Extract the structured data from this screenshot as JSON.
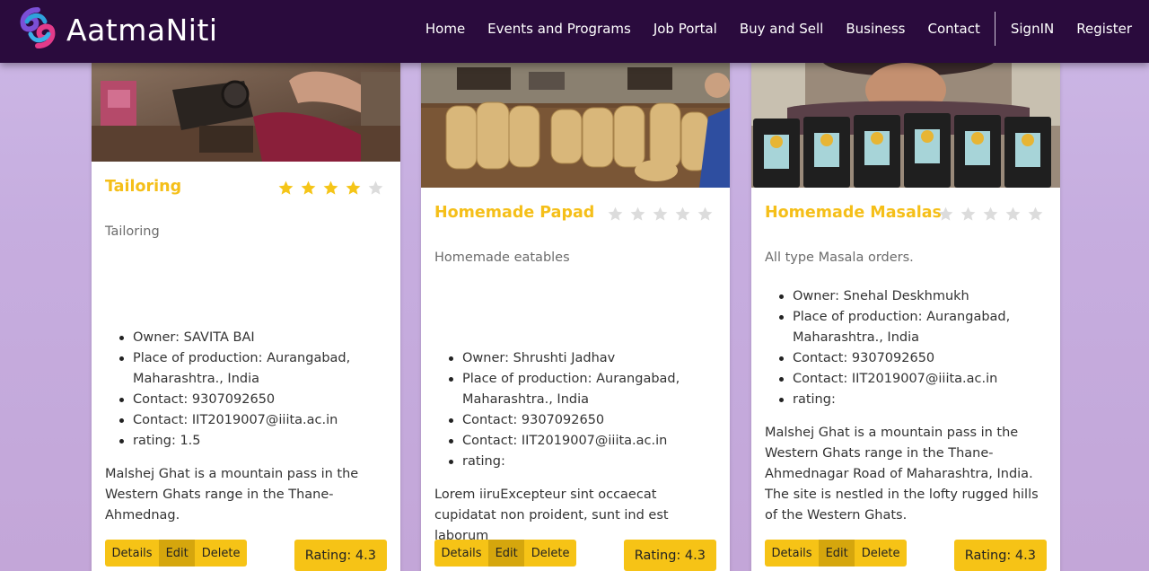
{
  "nav": {
    "brand": "AatmaNiti",
    "links": [
      "Home",
      "Events and Programs",
      "Job Portal",
      "Buy and Sell",
      "Business",
      "Contact"
    ],
    "signin": "SignIN",
    "register": "Register"
  },
  "colors": {
    "navbar": "#2a0b3d",
    "accent": "#f5bf19",
    "star_filled": "#f5c518",
    "star_empty": "#dcdcdc"
  },
  "cards": [
    {
      "title": "Tailoring",
      "stars_filled": 4,
      "stars_total": 5,
      "description": "Tailoring",
      "info": [
        "Owner: SAVITA BAI",
        "Place of production: Aurangabad, Maharashtra., India",
        "Contact: 9307092650",
        "Contact: IIT2019007@iiita.ac.in",
        "rating: 1.5"
      ],
      "text": "Malshej Ghat is a mountain pass in the Western Ghats range in the Thane-Ahmednag.",
      "buttons": {
        "details": "Details",
        "edit": "Edit",
        "delete": "Delete"
      },
      "rating": "Rating: 4.3"
    },
    {
      "title": "Homemade Papad",
      "stars_filled": 0,
      "stars_total": 5,
      "description": "Homemade eatables",
      "info": [
        "Owner: Shrushti Jadhav",
        "Place of production: Aurangabad, Maharashtra., India",
        "Contact: 9307092650",
        "Contact: IIT2019007@iiita.ac.in",
        "rating:"
      ],
      "text": "Lorem iiruExcepteur sint occaecat cupidatat non proident, sunt ind est laborum",
      "buttons": {
        "details": "Details",
        "edit": "Edit",
        "delete": "Delete"
      },
      "rating": "Rating: 4.3"
    },
    {
      "title": "Homemade Masalas",
      "stars_filled": 0,
      "stars_total": 5,
      "description": "All type Masala orders.",
      "info": [
        "Owner: Snehal Deskhmukh",
        "Place of production: Aurangabad, Maharashtra., India",
        "Contact: 9307092650",
        "Contact: IIT2019007@iiita.ac.in",
        "rating:"
      ],
      "text": "Malshej Ghat is a mountain pass in the Western Ghats range in the Thane-Ahmednagar Road of Maharashtra, India. The site is nestled in the lofty rugged hills of the Western Ghats.",
      "buttons": {
        "details": "Details",
        "edit": "Edit",
        "delete": "Delete"
      },
      "rating": "Rating: 4.3"
    }
  ]
}
